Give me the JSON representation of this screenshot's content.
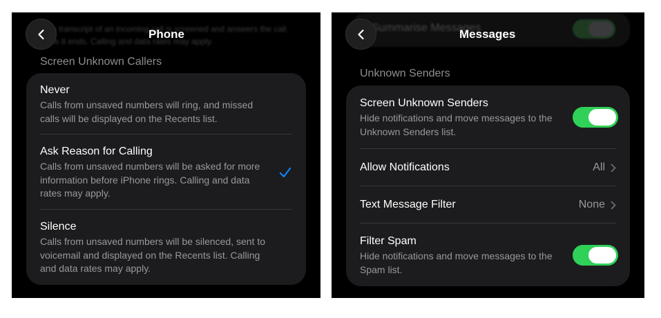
{
  "left_panel": {
    "ghost_lines": [
      "n transcript of an incoming call is screened and answers the call",
      "re it ends. Calling and data rates may apply."
    ],
    "back_icon": "chevron-left-icon",
    "title": "Phone",
    "section_header": "Screen Unknown Callers",
    "options": [
      {
        "title": "Never",
        "description": "Calls from unsaved numbers will ring, and missed calls will be displayed on the Recents list.",
        "selected": false
      },
      {
        "title": "Ask Reason for Calling",
        "description": "Calls from unsaved numbers will be asked for more information before iPhone rings. Calling and data rates may apply.",
        "selected": true
      },
      {
        "title": "Silence",
        "description": "Calls from unsaved numbers will be silenced, sent to voicemail and displayed on the Recents list. Calling and data rates may apply.",
        "selected": false
      }
    ],
    "check_icon": "checkmark-icon",
    "accent_color": "#0a84ff"
  },
  "right_panel": {
    "ghost_label": "Summarise Messages",
    "back_icon": "chevron-left-icon",
    "title": "Messages",
    "section_header": "Unknown Senders",
    "rows": [
      {
        "title": "Screen Unknown Senders",
        "description": "Hide notifications and move messages to the Unknown Senders list.",
        "toggle": true
      },
      {
        "title": "Allow Notifications",
        "value": "All"
      },
      {
        "title": "Text Message Filter",
        "value": "None"
      },
      {
        "title": "Filter Spam",
        "description": "Hide notifications and move messages to the Spam list.",
        "toggle": true
      }
    ],
    "toggle_on_color": "#30d158",
    "chevron_icon": "chevron-right-icon"
  }
}
